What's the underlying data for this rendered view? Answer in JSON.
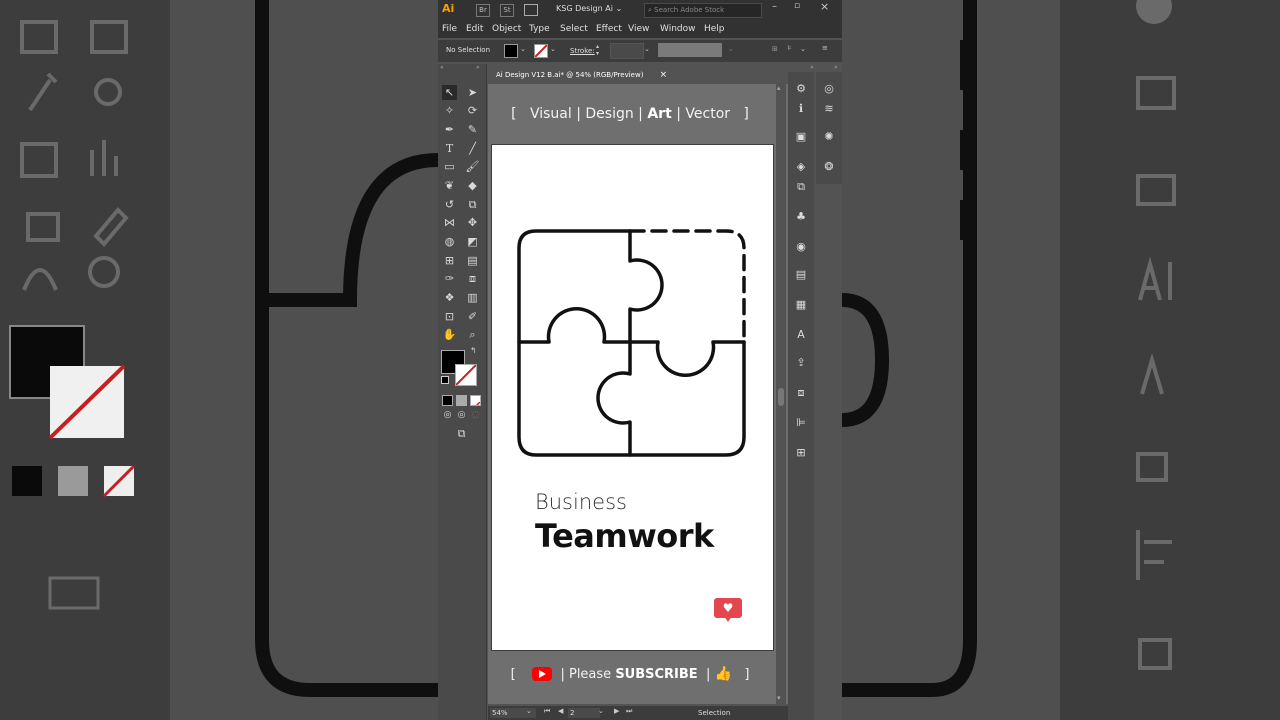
{
  "app": {
    "logo": "Ai",
    "bridge": "Br",
    "stock": "St",
    "workspace": "KSG Design Ai",
    "search_placeholder": "Search Adobe Stock"
  },
  "menu": [
    "File",
    "Edit",
    "Object",
    "Type",
    "Select",
    "Effect",
    "View",
    "Window",
    "Help"
  ],
  "control": {
    "selection": "No Selection",
    "stroke_label": "Stroke:"
  },
  "document": {
    "tab_title": "Ai Design V12 B.ai* @ 54% (RGB/Preview)",
    "close": "×"
  },
  "banner": {
    "open": "[",
    "w1": "Visual",
    "sep1": "|",
    "w2": "Design",
    "sep2": "|",
    "w3": "Art",
    "sep3": "|",
    "w4": "Vector",
    "close": "]"
  },
  "artwork": {
    "line1": "Business",
    "line2": "Teamwork"
  },
  "footer": {
    "open": "[",
    "sep": "|",
    "please": "Please",
    "subscribe": "SUBSCRIBE",
    "sep2": "|",
    "close": "]"
  },
  "status": {
    "zoom": "54%",
    "artboard": "2",
    "tool": "Selection"
  },
  "colors": {
    "accent": "#ff9a00",
    "heart": "#e2474f",
    "youtube": "#ff0000"
  }
}
